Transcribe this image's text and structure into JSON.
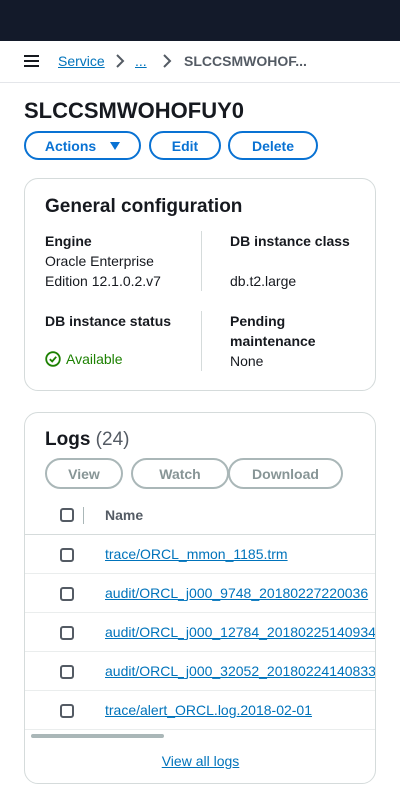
{
  "breadcrumbs": {
    "service": "Service",
    "ellipsis": "...",
    "current": "SLCCSMWOHOF..."
  },
  "page": {
    "title": "SLCCSMWOHOFUY0"
  },
  "actions": {
    "actions_label": "Actions",
    "edit_label": "Edit",
    "delete_label": "Delete"
  },
  "general_config": {
    "title": "General configuration",
    "engine_label": "Engine",
    "engine_value": "Oracle Enterprise Edition 12.1.0.2.v7",
    "class_label": "DB instance class",
    "class_value": "db.t2.large",
    "status_label": "DB instance status",
    "status_value": "Available",
    "maintenance_label": "Pending maintenance",
    "maintenance_value": "None"
  },
  "logs": {
    "title": "Logs",
    "count": "(24)",
    "view_label": "View",
    "watch_label": "Watch",
    "download_label": "Download",
    "column_name": "Name",
    "rows": [
      "trace/ORCL_mmon_1185.trm",
      "audit/ORCL_j000_9748_20180227220036",
      "audit/ORCL_j000_12784_20180225140934",
      "audit/ORCL_j000_32052_20180224140833",
      "trace/alert_ORCL.log.2018-02-01"
    ],
    "view_all_label": "View all logs"
  },
  "colors": {
    "topbar": "#131a2a",
    "link": "#0073bb",
    "primary_button": "#0972d3",
    "success": "#1d8102",
    "disabled": "#879596"
  },
  "icons": {
    "menu": "hamburger-menu-icon",
    "separator": "chevron-right-icon",
    "actions_caret": "caret-down-icon",
    "status": "check-circle-icon"
  }
}
